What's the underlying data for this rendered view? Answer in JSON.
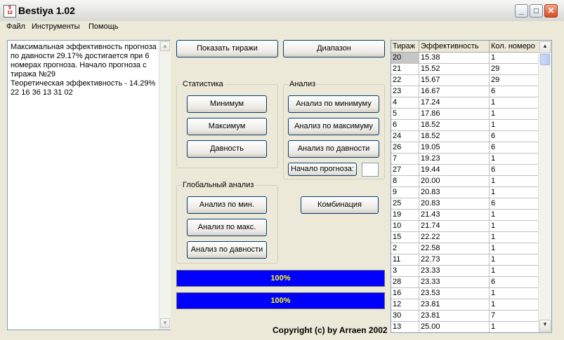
{
  "window": {
    "title": "Bestiya 1.02",
    "icon": "app-icon"
  },
  "menu": [
    "Файл",
    "Инструменты",
    "Помощь"
  ],
  "memo": {
    "text": "Максимальная эффективность прогноза по давности 29.17% достигается при 6 номерах прогноза. Начало прогноза с тиража №29\nТеоретическая эффективность - 14.29%\n22 16 36 13 31 02"
  },
  "buttons": {
    "show_draws": "Показать тиражи",
    "range": "Диапазон",
    "combination": "Комбинация"
  },
  "statistics": {
    "title": "Статистика",
    "min": "Минимум",
    "max": "Максимум",
    "age": "Давность"
  },
  "analysis": {
    "title": "Анализ",
    "by_min": "Анализ по минимуму",
    "by_max": "Анализ по максимуму",
    "by_age": "Анализ по давности",
    "forecast_start": "Начало прогноза:",
    "forecast_value": ""
  },
  "global_analysis": {
    "title": "Глобальный анализ",
    "by_min": "Анализ по мин.",
    "by_max": "Анализ по макс.",
    "by_age": "Анализ по давности"
  },
  "progress": [
    {
      "label": "100%",
      "value": 1.0
    },
    {
      "label": "100%",
      "value": 1.0
    }
  ],
  "copyright": "Copyright (c) by Arraen 2002",
  "grid": {
    "columns": [
      "Тираж",
      "Эффективность",
      "Кол. номеро"
    ],
    "rows": [
      [
        "20",
        "15.38",
        "1"
      ],
      [
        "21",
        "15.52",
        "29"
      ],
      [
        "22",
        "15.67",
        "29"
      ],
      [
        "23",
        "16.67",
        "6"
      ],
      [
        "4",
        "17.24",
        "1"
      ],
      [
        "5",
        "17.86",
        "1"
      ],
      [
        "6",
        "18.52",
        "1"
      ],
      [
        "24",
        "18.52",
        "6"
      ],
      [
        "26",
        "19.05",
        "6"
      ],
      [
        "7",
        "19.23",
        "1"
      ],
      [
        "27",
        "19.44",
        "6"
      ],
      [
        "8",
        "20.00",
        "1"
      ],
      [
        "9",
        "20.83",
        "1"
      ],
      [
        "25",
        "20.83",
        "6"
      ],
      [
        "19",
        "21.43",
        "1"
      ],
      [
        "10",
        "21.74",
        "1"
      ],
      [
        "15",
        "22.22",
        "1"
      ],
      [
        "2",
        "22.58",
        "1"
      ],
      [
        "11",
        "22.73",
        "1"
      ],
      [
        "3",
        "23.33",
        "1"
      ],
      [
        "28",
        "23.33",
        "6"
      ],
      [
        "16",
        "23.53",
        "1"
      ],
      [
        "12",
        "23.81",
        "1"
      ],
      [
        "30",
        "23.81",
        "7"
      ],
      [
        "13",
        "25.00",
        "1"
      ]
    ],
    "selected_row": 0
  }
}
